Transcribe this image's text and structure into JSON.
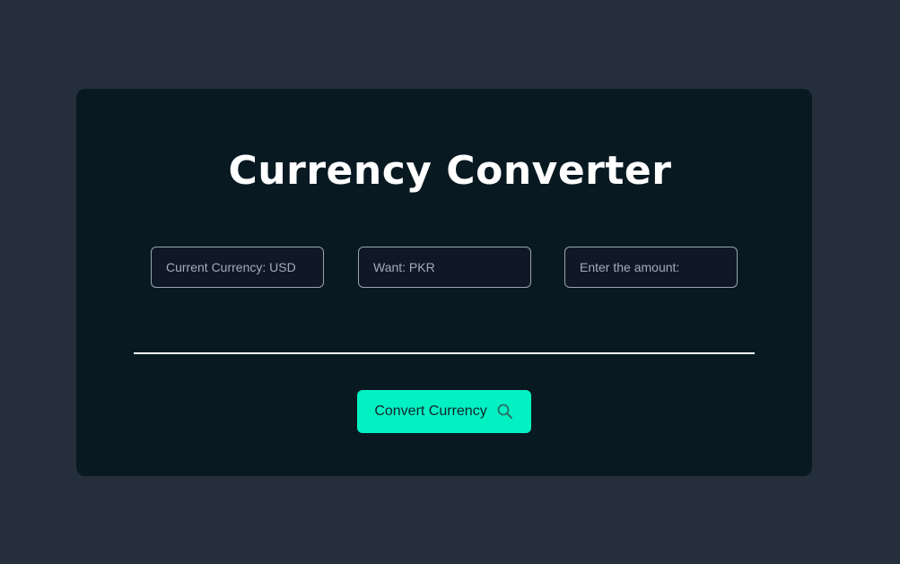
{
  "page": {
    "title": "Currency Converter"
  },
  "form": {
    "current_currency_placeholder": "Current Currency: USD",
    "want_placeholder": "Want: PKR",
    "amount_placeholder": "Enter the amount:"
  },
  "actions": {
    "convert_label": "Convert Currency",
    "convert_icon": "search-icon"
  },
  "colors": {
    "background": "#252f3c",
    "card": "#081922",
    "accent": "#02f1c2"
  }
}
